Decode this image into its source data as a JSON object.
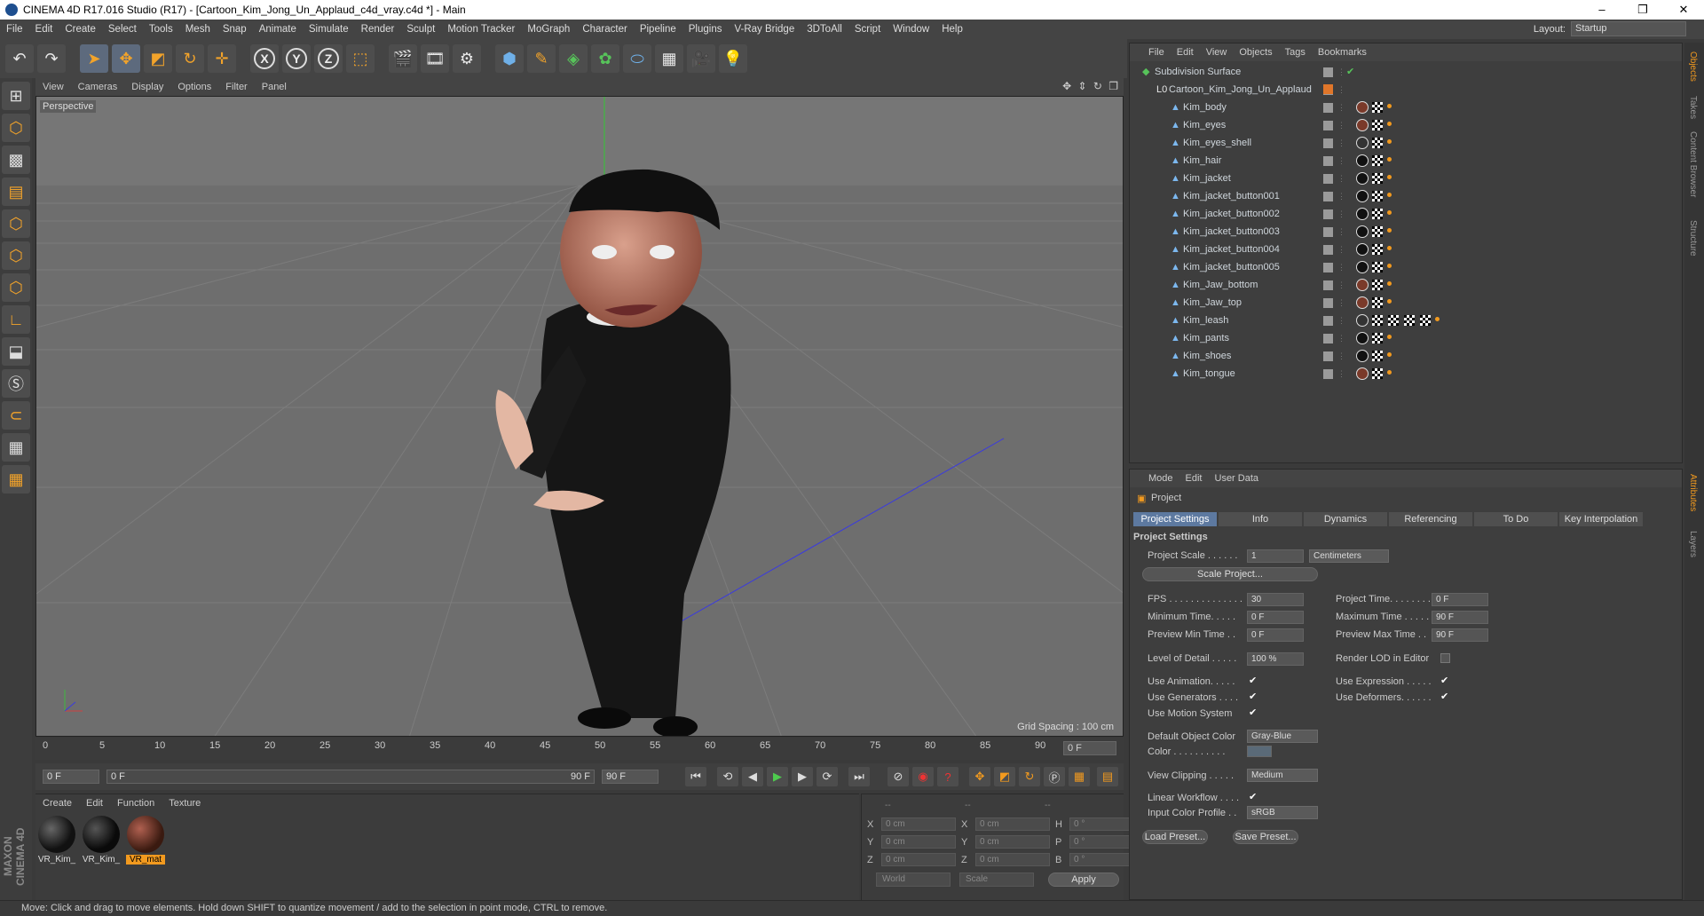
{
  "window": {
    "title": "CINEMA 4D R17.016 Studio (R17) - [Cartoon_Kim_Jong_Un_Applaud_c4d_vray.c4d *] - Main",
    "buttons": [
      "–",
      "❐",
      "✕"
    ]
  },
  "menubar": {
    "items": [
      "File",
      "Edit",
      "Create",
      "Select",
      "Tools",
      "Mesh",
      "Snap",
      "Animate",
      "Simulate",
      "Render",
      "Sculpt",
      "Motion Tracker",
      "MoGraph",
      "Character",
      "Pipeline",
      "Plugins",
      "V-Ray Bridge",
      "3DToAll",
      "Script",
      "Window",
      "Help"
    ],
    "layout_label": "Layout:",
    "layout_value": "Startup"
  },
  "viewport": {
    "menu": [
      "View",
      "Cameras",
      "Display",
      "Options",
      "Filter",
      "Panel"
    ],
    "label": "Perspective",
    "grid_spacing": "Grid Spacing : 100 cm"
  },
  "timeline": {
    "ticks": [
      "0",
      "5",
      "10",
      "15",
      "20",
      "25",
      "30",
      "35",
      "40",
      "45",
      "50",
      "55",
      "60",
      "65",
      "70",
      "75",
      "80",
      "85",
      "90"
    ],
    "current": "0 F"
  },
  "transport": {
    "start": "0 F",
    "slider_start": "0 F",
    "slider_end": "90 F",
    "end": "90 F"
  },
  "materials": {
    "menu": [
      "Create",
      "Edit",
      "Function",
      "Texture"
    ],
    "items": [
      {
        "name": "VR_Kim_",
        "color": "#1a1a1a"
      },
      {
        "name": "VR_Kim_",
        "color": "#222"
      },
      {
        "name": "VR_mat",
        "color": "#7a3a2a"
      }
    ]
  },
  "coords": {
    "headers": [
      "--",
      "--",
      "--"
    ],
    "rows": [
      {
        "a": "X",
        "v1": "0 cm",
        "b": "X",
        "v2": "0 cm",
        "c": "H",
        "v3": "0 °"
      },
      {
        "a": "Y",
        "v1": "0 cm",
        "b": "Y",
        "v2": "0 cm",
        "c": "P",
        "v3": "0 °"
      },
      {
        "a": "Z",
        "v1": "0 cm",
        "b": "Z",
        "v2": "0 cm",
        "c": "B",
        "v3": "0 °"
      }
    ],
    "world": "World",
    "scale": "Scale",
    "apply": "Apply"
  },
  "status": "Move: Click and drag to move elements. Hold down SHIFT to quantize movement / add to the selection in point mode, CTRL to remove.",
  "objects": {
    "menu": [
      "File",
      "Edit",
      "View",
      "Objects",
      "Tags",
      "Bookmarks"
    ],
    "root": "Subdivision Surface",
    "group": "Cartoon_Kim_Jong_Un_Applaud",
    "children": [
      "Kim_body",
      "Kim_eyes",
      "Kim_eyes_shell",
      "Kim_hair",
      "Kim_jacket",
      "Kim_jacket_button001",
      "Kim_jacket_button002",
      "Kim_jacket_button003",
      "Kim_jacket_button004",
      "Kim_jacket_button005",
      "Kim_Jaw_bottom",
      "Kim_Jaw_top",
      "Kim_leash",
      "Kim_pants",
      "Kim_shoes",
      "Kim_tongue"
    ],
    "tag_colors": [
      "#7a3a2a",
      "#7a3a2a",
      "#333",
      "#111",
      "#111",
      "#111",
      "#111",
      "#111",
      "#111",
      "#111",
      "#7a3a2a",
      "#7a3a2a",
      "#333",
      "#111",
      "#111",
      "#7a3a2a"
    ]
  },
  "attributes": {
    "menu": [
      "Mode",
      "Edit",
      "User Data"
    ],
    "title": "Project",
    "tabs": [
      "Project Settings",
      "Info",
      "Dynamics",
      "Referencing",
      "To Do",
      "Key Interpolation"
    ],
    "section": "Project Settings",
    "project_scale_label": "Project Scale . . . . . .",
    "project_scale": "1",
    "project_scale_unit": "Centimeters",
    "scale_project": "Scale Project...",
    "fps_label": "FPS . . . . . . . . . . . . . .",
    "fps": "30",
    "project_time_label": "Project Time. . . . . . . .",
    "project_time": "0 F",
    "min_time_label": "Minimum Time. . . . .",
    "min_time": "0 F",
    "max_time_label": "Maximum Time . . . . .",
    "max_time": "90 F",
    "prev_min_label": "Preview Min Time . .",
    "prev_min": "0 F",
    "prev_max_label": "Preview Max Time . .",
    "prev_max": "90 F",
    "lod_label": "Level of Detail . . . . .",
    "lod": "100 %",
    "render_lod_label": "Render LOD in Editor",
    "use_anim": "Use Animation. . . . .",
    "use_expr": "Use Expression . . . . .",
    "use_gen": "Use Generators . . . .",
    "use_def": "Use Deformers. . . . . .",
    "use_motion": "Use Motion System",
    "def_color_label": "Default Object Color",
    "def_color": "Gray-Blue",
    "color_label": "Color . . . . . . . . . .",
    "view_clip_label": "View Clipping . . . . .",
    "view_clip": "Medium",
    "linear_label": "Linear Workflow . . . .",
    "input_profile_label": "Input Color Profile . .",
    "input_profile": "sRGB",
    "load_preset": "Load Preset...",
    "save_preset": "Save Preset..."
  },
  "sidetabs": [
    "Objects",
    "Takes",
    "Content Browser",
    "Structure",
    "Attributes",
    "Layers"
  ]
}
